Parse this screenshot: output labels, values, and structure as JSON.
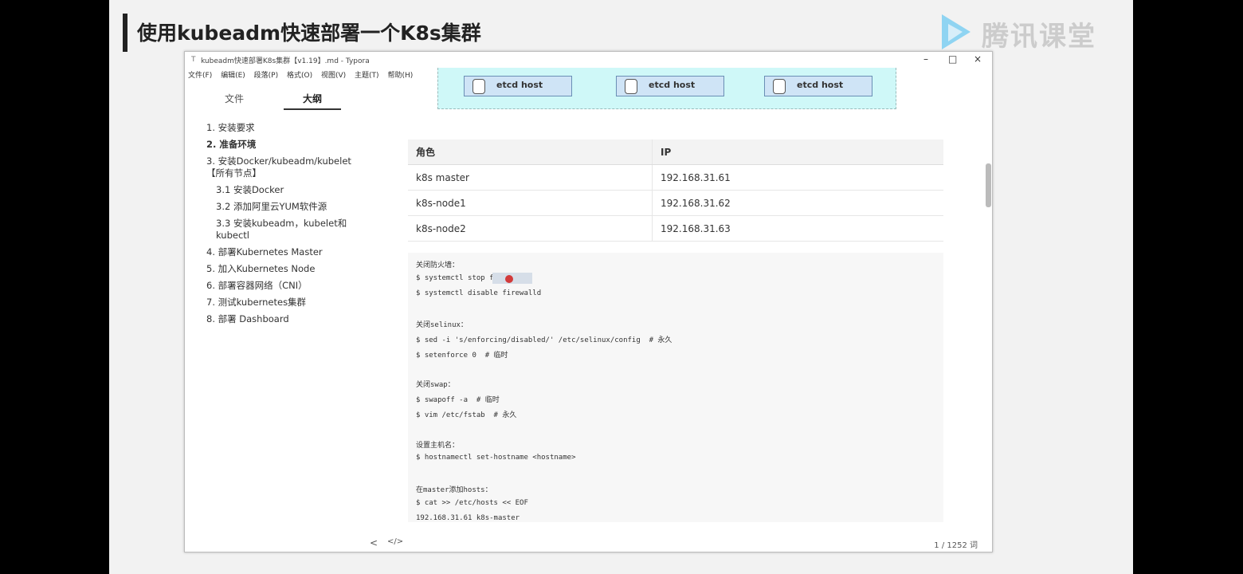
{
  "slide": {
    "title": "使用kubeadm快速部署一个K8s集群",
    "logo_text": "腾讯课堂"
  },
  "window": {
    "title": "kubeadm快速部署K8s集群【v1.19】.md - Typora",
    "menu": [
      "文件(F)",
      "编辑(E)",
      "段落(P)",
      "格式(O)",
      "视图(V)",
      "主题(T)",
      "帮助(H)"
    ],
    "controls": {
      "minimize": "–",
      "maximize": "□",
      "close": "×"
    }
  },
  "sidebar": {
    "tabs": [
      "文件",
      "大纲"
    ],
    "active_tab": "大纲",
    "outline": [
      {
        "label": "1. 安装要求",
        "level": 1
      },
      {
        "label": "2. 准备环境",
        "level": 1,
        "bold": true
      },
      {
        "label": "3. 安装Docker/kubeadm/kubelet【所有节点】",
        "level": 1
      },
      {
        "label": "3.1 安装Docker",
        "level": 2
      },
      {
        "label": "3.2 添加阿里云YUM软件源",
        "level": 2
      },
      {
        "label": "3.3 安装kubeadm，kubelet和kubectl",
        "level": 2
      },
      {
        "label": "4. 部署Kubernetes Master",
        "level": 1
      },
      {
        "label": "5. 加入Kubernetes Node",
        "level": 1
      },
      {
        "label": "6. 部署容器网络（CNI）",
        "level": 1
      },
      {
        "label": "7. 测试kubernetes集群",
        "level": 1
      },
      {
        "label": "8. 部署 Dashboard",
        "level": 1
      }
    ]
  },
  "content": {
    "etcd_hosts": [
      "etcd host",
      "etcd host",
      "etcd host"
    ],
    "table": {
      "headers": [
        "角色",
        "IP"
      ],
      "rows": [
        [
          "k8s master",
          "192.168.31.61"
        ],
        [
          "k8s-node1",
          "192.168.31.62"
        ],
        [
          "k8s-node2",
          "192.168.31.63"
        ]
      ]
    },
    "code_lines": [
      "关闭防火墙：",
      "$ systemctl stop firewalld",
      "$ systemctl disable firewalld",
      "",
      "关闭selinux：",
      "$ sed -i 's/enforcing/disabled/' /etc/selinux/config  # 永久",
      "$ setenforce 0  # 临时",
      "",
      "关闭swap：",
      "$ swapoff -a  # 临时",
      "$ vim /etc/fstab  # 永久",
      "",
      "设置主机名：",
      "$ hostnamectl set-hostname <hostname>",
      "",
      "在master添加hosts：",
      "$ cat >> /etc/hosts << EOF",
      "192.168.31.61 k8s-master"
    ]
  },
  "statusbar": {
    "nav_left": "<",
    "nav_source": "</>",
    "word_count": "1 / 1252 词"
  }
}
